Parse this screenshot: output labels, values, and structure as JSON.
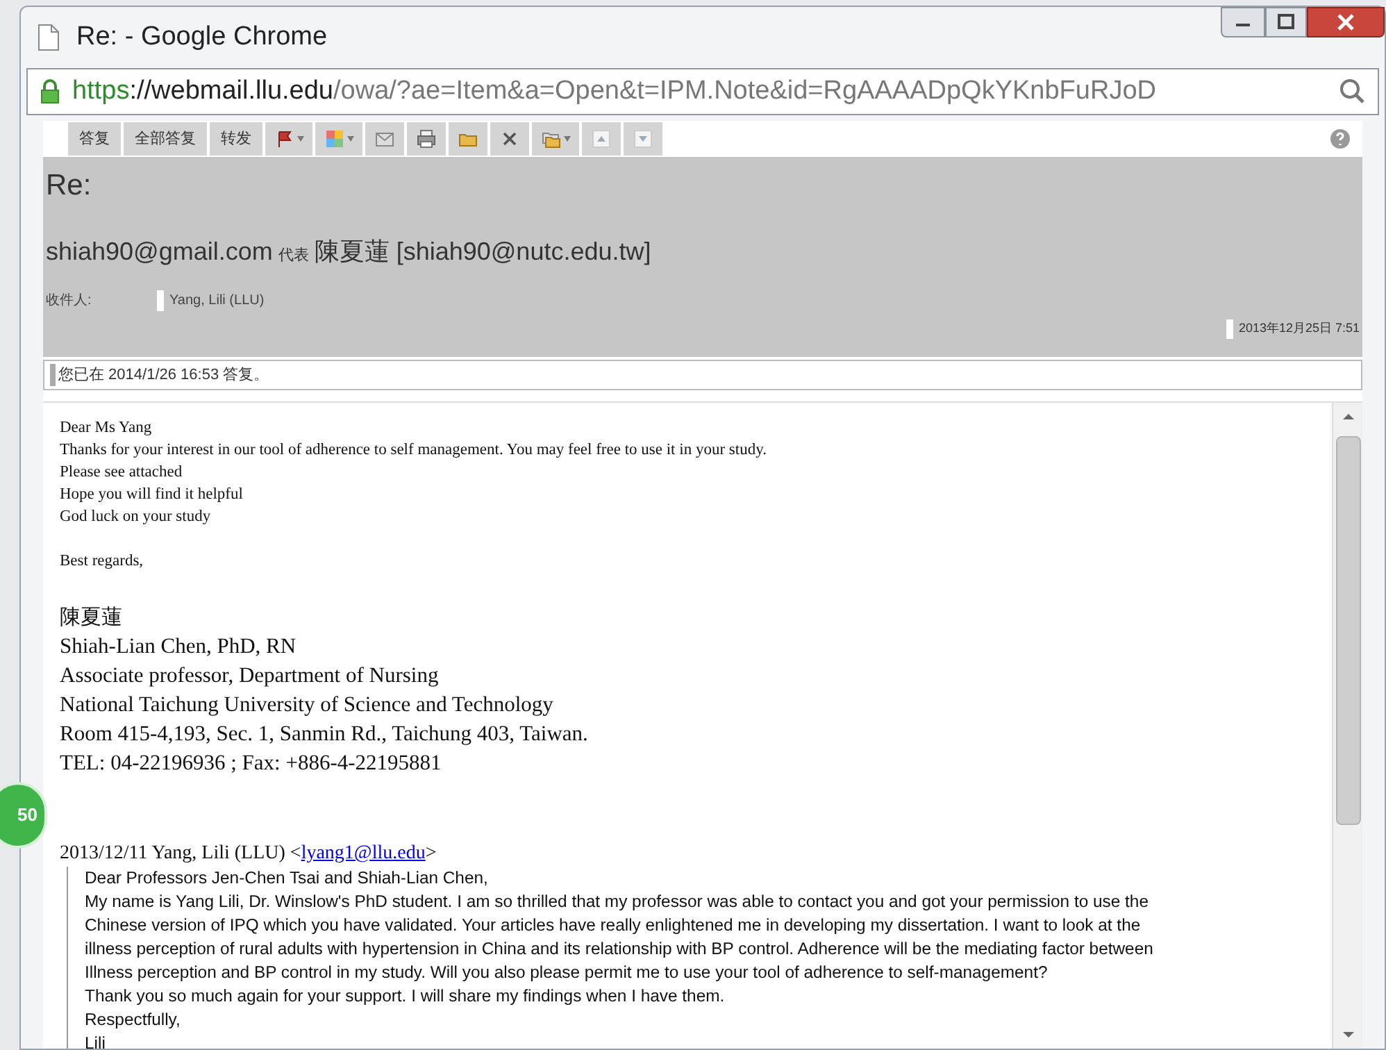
{
  "window": {
    "title": "Re: - Google Chrome"
  },
  "address_bar": {
    "scheme": "https",
    "host": "://webmail.llu.edu",
    "path": "/owa/?ae=Item&a=Open&t=IPM.Note&id=RgAAAADpQkYKnbFuRJoD"
  },
  "toolbar": {
    "buttons": [
      {
        "kind": "text",
        "label": "答复"
      },
      {
        "kind": "text",
        "label": "全部答复"
      },
      {
        "kind": "text",
        "label": "转发"
      },
      {
        "kind": "flag"
      },
      {
        "kind": "categories"
      },
      {
        "kind": "envelope"
      },
      {
        "kind": "print"
      },
      {
        "kind": "folder"
      },
      {
        "kind": "delete"
      },
      {
        "kind": "move"
      },
      {
        "kind": "up"
      },
      {
        "kind": "down"
      }
    ]
  },
  "header": {
    "subject": "Re:",
    "sender": "shiah90@gmail.com",
    "on_behalf": "代表",
    "sender_name": "陳夏蓮 [shiah90@nutc.edu.tw]",
    "to_label": "收件人:",
    "to_value": "Yang, Lili (LLU)",
    "date": "2013年12月25日 7:51"
  },
  "notice": "您已在 2014/1/26 16:53 答复。",
  "body": {
    "lines": [
      "Dear Ms Yang",
      "Thanks for your interest in our tool of adherence to self management. You may feel free to use it in your study.",
      "Please see attached",
      "Hope you will find it helpful",
      "God luck on your study"
    ],
    "closing": "Best regards,",
    "signature_name": "陳夏蓮",
    "signature": [
      "Shiah-Lian Chen, PhD, RN",
      "Associate professor, Department of Nursing",
      "National Taichung University of Science and Technology",
      "Room 415-4,193, Sec. 1, Sanmin Rd., Taichung 403, Taiwan.",
      "TEL: 04-22196936 ; Fax: +886-4-22195881"
    ],
    "quote_header": "2013/12/11 Yang, Lili (LLU) <",
    "quote_link": "lyang1@llu.edu",
    "quote_header_end": ">",
    "quote_lines": [
      "Dear Professors Jen-Chen Tsai and Shiah-Lian Chen,",
      "My name is Yang Lili, Dr. Winslow's PhD student. I am so thrilled that my professor was able to contact you and got your permission to use the",
      "Chinese version of IPQ which you have validated. Your articles have really enlightened me in developing my dissertation. I want to look at the",
      "illness perception of rural adults with hypertension in China and its relationship with BP control. Adherence will be the mediating factor between",
      "Illness perception and BP control in my study. Will you also please permit me to use your tool of adherence to self-management?",
      "Thank you so much again for your support. I will share my findings when I have them.",
      "Respectfully,",
      "Lili"
    ]
  },
  "badge": "50"
}
